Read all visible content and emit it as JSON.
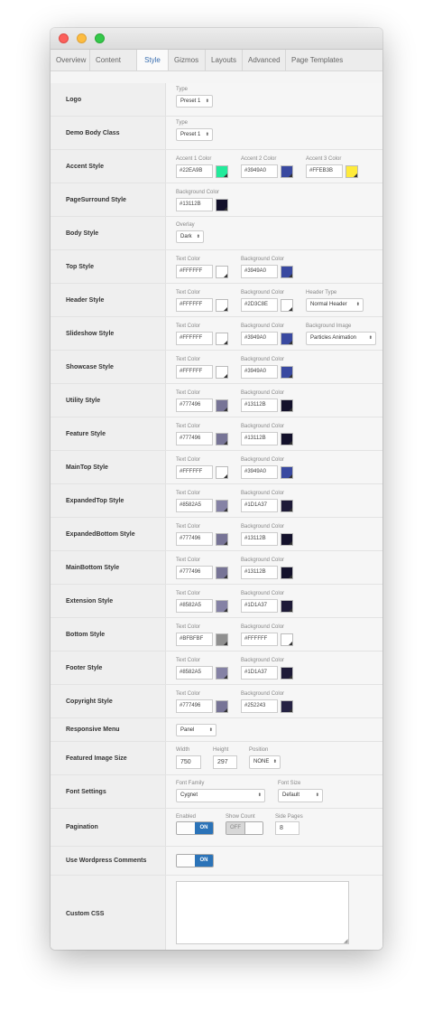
{
  "tabs": [
    "Overview",
    "Content",
    "Style",
    "Gizmos",
    "Layouts",
    "Advanced",
    "Page Templates"
  ],
  "active_tab": "Style",
  "rows": {
    "logo": {
      "label": "Logo",
      "type_label": "Type",
      "type_value": "Preset 1"
    },
    "demo_body_class": {
      "label": "Demo Body Class",
      "type_label": "Type",
      "type_value": "Preset 1"
    },
    "accent": {
      "label": "Accent Style",
      "a1_label": "Accent 1 Color",
      "a1_value": "#22EA9B",
      "a1_color": "#22EA9B",
      "a2_label": "Accent 2 Color",
      "a2_value": "#3949A0",
      "a2_color": "#3949A0",
      "a3_label": "Accent 3 Color",
      "a3_value": "#FFEB3B",
      "a3_color": "#FFEB3B"
    },
    "pagesurround": {
      "label": "PageSurround Style",
      "bg_label": "Background Color",
      "bg_value": "#13112B",
      "bg_color": "#13112B"
    },
    "body": {
      "label": "Body Style",
      "overlay_label": "Overlay",
      "overlay_value": "Dark"
    },
    "top": {
      "label": "Top Style",
      "text_label": "Text Color",
      "text_value": "#FFFFFF",
      "text_color": "#FFFFFF",
      "bg_label": "Background Color",
      "bg_value": "#3949A0",
      "bg_color": "#3949A0"
    },
    "header": {
      "label": "Header Style",
      "text_label": "Text Color",
      "text_value": "#FFFFFF",
      "text_color": "#FFFFFF",
      "bg_label": "Background Color",
      "bg_value": "#2D3C8E",
      "bg_color": "#FFFFFF",
      "ht_label": "Header Type",
      "ht_value": "Normal Header"
    },
    "slideshow": {
      "label": "Slideshow Style",
      "text_label": "Text Color",
      "text_value": "#FFFFFF",
      "text_color": "#FFFFFF",
      "bg_label": "Background Color",
      "bg_value": "#3949A0",
      "bg_color": "#3949A0",
      "bi_label": "Background Image",
      "bi_value": "Particles Animation"
    },
    "showcase": {
      "label": "Showcase Style",
      "text_label": "Text Color",
      "text_value": "#FFFFFF",
      "text_color": "#FFFFFF",
      "bg_label": "Background Color",
      "bg_value": "#3949A0",
      "bg_color": "#3949A0"
    },
    "utility": {
      "label": "Utility Style",
      "text_label": "Text Color",
      "text_value": "#777496",
      "text_color": "#777496",
      "bg_label": "Background Color",
      "bg_value": "#13112B",
      "bg_color": "#13112B"
    },
    "feature": {
      "label": "Feature Style",
      "text_label": "Text Color",
      "text_value": "#777496",
      "text_color": "#777496",
      "bg_label": "Background Color",
      "bg_value": "#13112B",
      "bg_color": "#13112B"
    },
    "maintop": {
      "label": "MainTop Style",
      "text_label": "Text Color",
      "text_value": "#FFFFFF",
      "text_color": "#FFFFFF",
      "bg_label": "Background Color",
      "bg_value": "#3949A0",
      "bg_color": "#3949A0"
    },
    "expandedtop": {
      "label": "ExpandedTop Style",
      "text_label": "Text Color",
      "text_value": "#8582A5",
      "text_color": "#8582A5",
      "bg_label": "Background Color",
      "bg_value": "#1D1A37",
      "bg_color": "#1D1A37"
    },
    "expandedbottom": {
      "label": "ExpandedBottom Style",
      "text_label": "Text Color",
      "text_value": "#777496",
      "text_color": "#777496",
      "bg_label": "Background Color",
      "bg_value": "#13112B",
      "bg_color": "#13112B"
    },
    "mainbottom": {
      "label": "MainBottom Style",
      "text_label": "Text Color",
      "text_value": "#777496",
      "text_color": "#777496",
      "bg_label": "Background Color",
      "bg_value": "#13112B",
      "bg_color": "#13112B"
    },
    "extension": {
      "label": "Extension Style",
      "text_label": "Text Color",
      "text_value": "#8582A5",
      "text_color": "#8582A5",
      "bg_label": "Background Color",
      "bg_value": "#1D1A37",
      "bg_color": "#1D1A37"
    },
    "bottom": {
      "label": "Bottom Style",
      "text_label": "Text Color",
      "text_value": "#BFBFBF",
      "text_color": "#8F8F8F",
      "bg_label": "Background Color",
      "bg_value": "#FFFFFF",
      "bg_color": "#FFFFFF"
    },
    "footer": {
      "label": "Footer Style",
      "text_label": "Text Color",
      "text_value": "#8582A5",
      "text_color": "#8582A5",
      "bg_label": "Background Color",
      "bg_value": "#1D1A37",
      "bg_color": "#1D1A37"
    },
    "copyright": {
      "label": "Copyright Style",
      "text_label": "Text Color",
      "text_value": "#777496",
      "text_color": "#777496",
      "bg_label": "Background Color",
      "bg_value": "#252243",
      "bg_color": "#252243"
    },
    "responsive_menu": {
      "label": "Responsive Menu",
      "value": "Panel"
    },
    "featured_image": {
      "label": "Featured Image Size",
      "w_label": "Width",
      "w_value": "750",
      "h_label": "Height",
      "h_value": "297",
      "p_label": "Position",
      "p_value": "NONE"
    },
    "font": {
      "label": "Font Settings",
      "ff_label": "Font Family",
      "ff_value": "Cygnet",
      "fs_label": "Font Size",
      "fs_value": "Default"
    },
    "pagination": {
      "label": "Pagination",
      "enabled_label": "Enabled",
      "enabled_state": "ON",
      "count_label": "Show Count",
      "count_state": "OFF",
      "side_label": "Side Pages",
      "side_value": "8"
    },
    "wp_comments": {
      "label": "Use Wordpress Comments",
      "state": "ON"
    },
    "custom_css": {
      "label": "Custom CSS",
      "value": ""
    }
  }
}
